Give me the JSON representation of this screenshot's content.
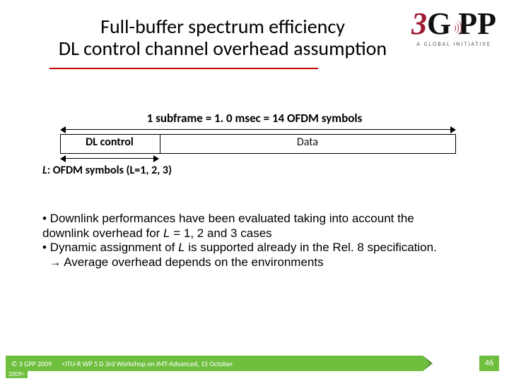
{
  "header": {
    "title_line1": "Full-buffer spectrum efficiency",
    "title_line2": "DL control channel overhead assumption",
    "logo": {
      "digit": "3",
      "g": "G",
      "pp": "PP",
      "tagline": "A GLOBAL INITIATIVE"
    }
  },
  "diagram": {
    "subframe_heading": "1 subframe = 1. 0 msec = 14 OFDM symbols",
    "dl_label": "DL control",
    "data_label": "Data",
    "l_label_prefix": "L",
    "l_label_rest": ": OFDM symbols (L=1, 2, 3)"
  },
  "bullets": {
    "b1_a": "• Downlink performances have been evaluated taking into account the",
    "b1_b": "downlink overhead for ",
    "b1_L": "L",
    "b1_c": " = 1, 2 and 3 cases",
    "b2_a": "• Dynamic assignment of ",
    "b2_L": "L",
    "b2_b": " is supported already in the Rel. 8 specification.",
    "b3_arrow": "→",
    "b3_text": " Average overhead depends on the environments"
  },
  "footer": {
    "copyright": "© 3 GPP 2009",
    "subtitle": "<ITU-R WP 5 D 3rd Workshop on IMT-Advanced, 15 October",
    "year_extra": "2009>",
    "page": "46"
  }
}
